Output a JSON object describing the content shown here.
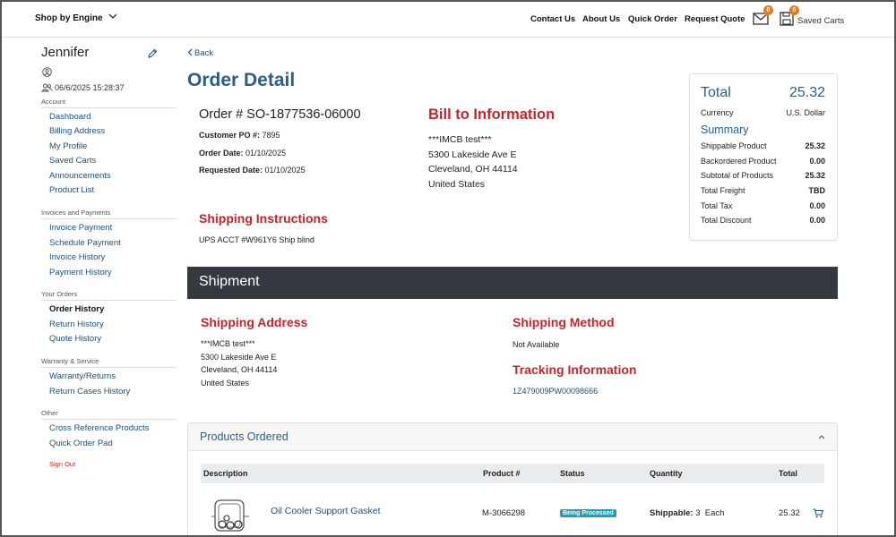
{
  "header": {
    "shop_by": "Shop by Engine",
    "links": [
      "Contact Us",
      "About Us",
      "Quick Order",
      "Request Quote"
    ],
    "messages_count": "0",
    "saved_carts_count": "0",
    "saved_carts_label": "Saved Carts"
  },
  "sidebar": {
    "user_name": "Jennifer",
    "last_login": "06/6/2025 15:28:37",
    "sections": [
      {
        "title": "Account",
        "items": [
          "Dashboard",
          "Billing Address",
          "My Profile",
          "Saved Carts",
          "Announcements",
          "Product List"
        ]
      },
      {
        "title": "Invoices and Payments",
        "items": [
          "Invoice Payment",
          "Schedule Payment",
          "Invoice History",
          "Payment History"
        ]
      },
      {
        "title": "Your Orders",
        "items": [
          "Order History",
          "Return History",
          "Quote History"
        ]
      },
      {
        "title": "Warranty & Service",
        "items": [
          "Warranty/Returns",
          "Return Cases History"
        ]
      },
      {
        "title": "Other",
        "items": [
          "Cross Reference Products",
          "Quick Order Pad"
        ]
      }
    ],
    "sign_out": "Sign Out"
  },
  "main": {
    "back": "Back",
    "title": "Order Detail",
    "order_number": "Order # SO-1877536-06000",
    "customer_po_label": "Customer PO #:",
    "customer_po": "7895",
    "order_date_label": "Order Date:",
    "order_date": "01/10/2025",
    "requested_date_label": "Requested Date:",
    "requested_date": "01/10/2025",
    "bill_to_heading": "Bill to Information",
    "bill_to": [
      "***IMCB test***",
      "5300 Lakeside Ave E",
      "Cleveland, OH 44114",
      "United States"
    ],
    "shipping_instructions_heading": "Shipping Instructions",
    "shipping_instructions": "UPS ACCT #W961Y6 Ship blind"
  },
  "totals": {
    "total_label": "Total",
    "total_value": "25.32",
    "currency_label": "Currency",
    "currency_value": "U.S. Dollar",
    "summary_label": "Summary",
    "rows": [
      {
        "label": "Shippable Product",
        "value": "25.32"
      },
      {
        "label": "Backordered Product",
        "value": "0.00"
      },
      {
        "label": "Subtotal of Products",
        "value": "25.32"
      },
      {
        "label": "Total Freight",
        "value": "TBD"
      },
      {
        "label": "Total Tax",
        "value": "0.00"
      },
      {
        "label": "Total Discount",
        "value": "0.00"
      }
    ]
  },
  "shipment": {
    "band_title": "Shipment",
    "shipping_address_heading": "Shipping Address",
    "shipping_address": [
      "***IMCB test***",
      "5300 Lakeside Ave E",
      "Cleveland, OH 44114",
      "United States"
    ],
    "shipping_method_heading": "Shipping Method",
    "shipping_method": "Not Available",
    "tracking_heading": "Tracking Information",
    "tracking_number": "1Z479009PW00098666"
  },
  "products": {
    "heading": "Products Ordered",
    "columns": [
      "Description",
      "Product #",
      "Status",
      "Quantity",
      "Total"
    ],
    "rows": [
      {
        "description": "Oil Cooler Support Gasket",
        "product_number": "M-3066298",
        "status": "Being Processed",
        "quantity_label": "Shippable:",
        "quantity": "3",
        "unit": "Each",
        "total": "25.32"
      }
    ]
  },
  "colors": {
    "accent_blue": "#2a5f86",
    "link_blue": "#1e4f75",
    "heading_red": "#c0262d",
    "badge_orange": "#e8791e",
    "band_dark": "#343a40",
    "status_teal": "#17a2b8"
  }
}
